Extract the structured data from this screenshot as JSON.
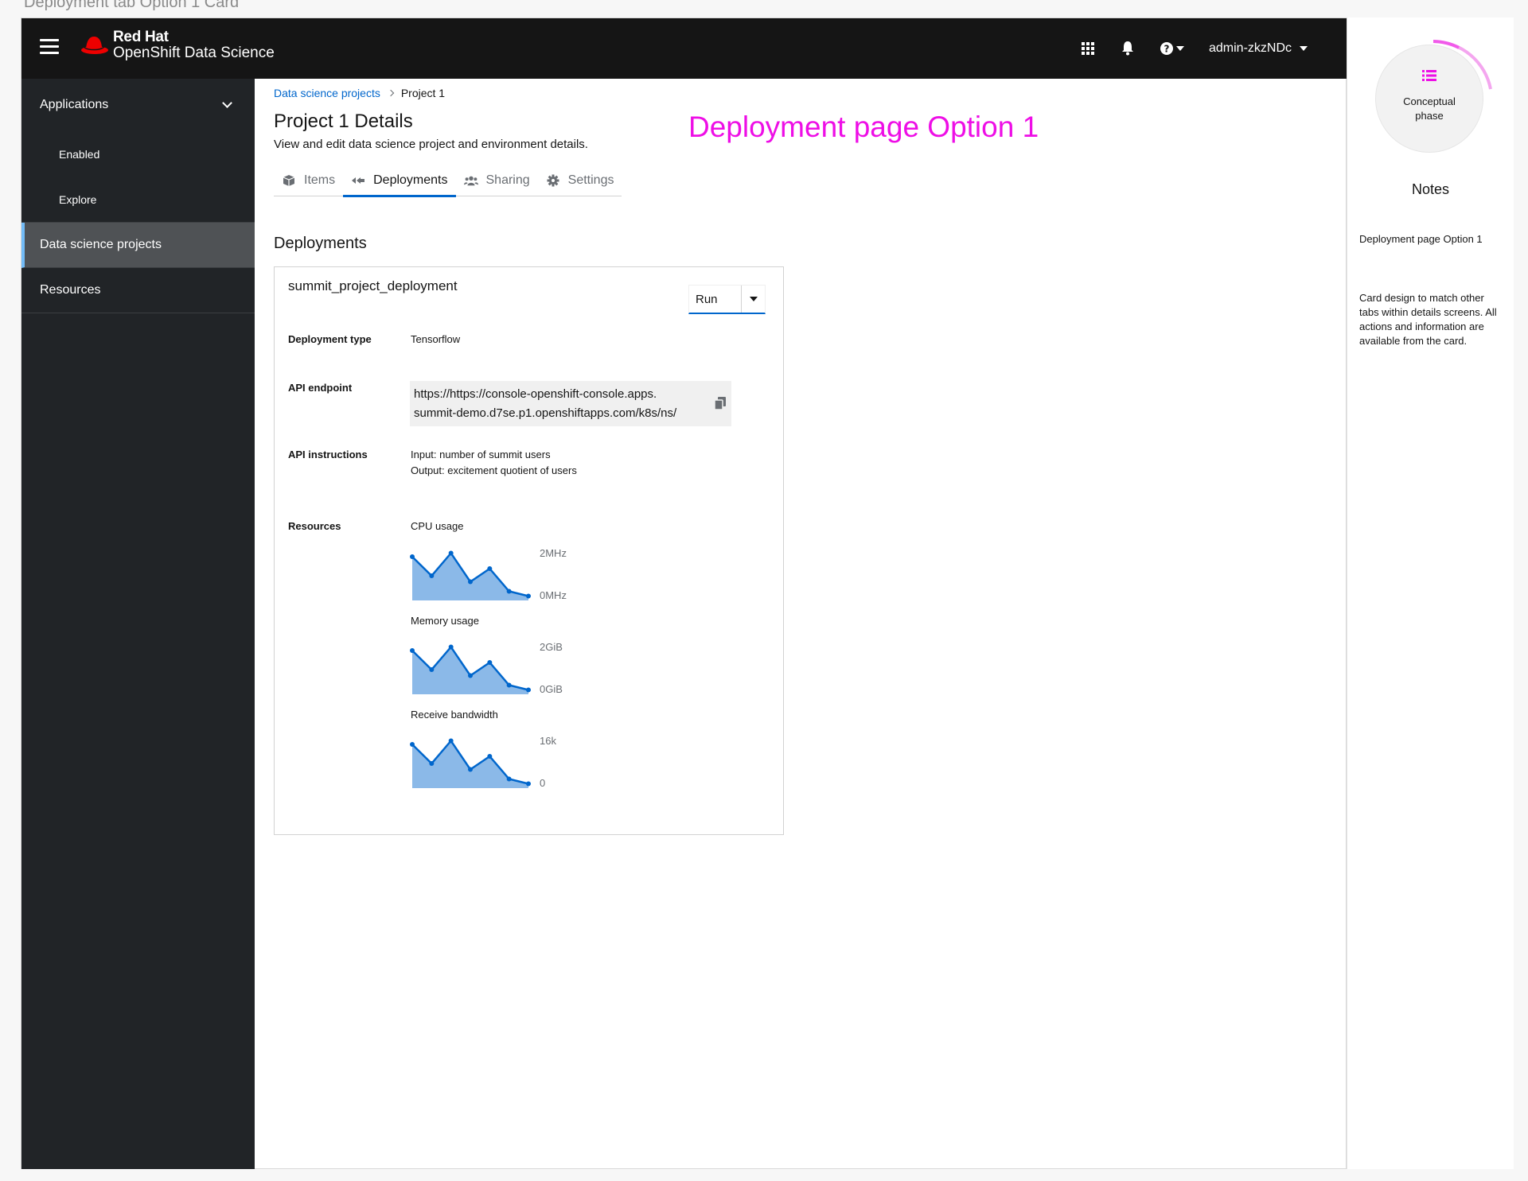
{
  "frame_title": "Deployment tab Option 1 Card",
  "masthead": {
    "brand": "Red Hat",
    "product": "OpenShift Data Science",
    "user": "admin-zkzNDc"
  },
  "sidebar": {
    "group_label": "Applications",
    "sub_items": [
      "Enabled",
      "Explore"
    ],
    "items": [
      "Data science projects",
      "Resources"
    ]
  },
  "breadcrumb": {
    "parent": "Data science projects",
    "current": "Project 1"
  },
  "page": {
    "title": "Project 1 Details",
    "subtitle": "View and edit data science project and environment details.",
    "option_label": "Deployment page Option 1"
  },
  "tabs": [
    "Items",
    "Deployments",
    "Sharing",
    "Settings"
  ],
  "section_title": "Deployments",
  "card": {
    "title": "summit_project_deployment",
    "action_label": "Run",
    "deployment_type_label": "Deployment type",
    "deployment_type_value": "Tensorflow",
    "api_endpoint_label": "API endpoint",
    "api_endpoint_line1": "https://https://console-openshift-console.apps.",
    "api_endpoint_line2": "summit-demo.d7se.p1.openshiftapps.com/k8s/ns/",
    "api_instructions_label": "API instructions",
    "api_instructions_line1": "Input: number of summit users",
    "api_instructions_line2": "Output: excitement quotient of users",
    "resources_label": "Resources"
  },
  "metrics": [
    {
      "label": "CPU usage",
      "max": "2MHz",
      "min": "0MHz",
      "values": [
        1.7,
        0.9,
        1.85,
        0.65,
        1.2,
        0.25,
        0.05
      ]
    },
    {
      "label": "Memory usage",
      "max": "2GiB",
      "min": "0GiB",
      "values": [
        1.7,
        0.9,
        1.85,
        0.65,
        1.2,
        0.25,
        0.05
      ]
    },
    {
      "label": "Receive bandwidth",
      "max": "16k",
      "min": "0",
      "values": [
        13.6,
        7.2,
        14.8,
        5.2,
        9.6,
        2.0,
        0.4
      ]
    }
  ],
  "notes": {
    "phase": "Conceptual phase",
    "title": "Notes",
    "line1": "Deployment page Option 1",
    "line2": "Card design to match other tabs within details screens. All actions and information are available from the card."
  },
  "colors": {
    "accent": "#0066cc",
    "annotation": "#ee0ee6",
    "chart_fill": "#8bb9e8",
    "chart_line": "#0066cc"
  }
}
